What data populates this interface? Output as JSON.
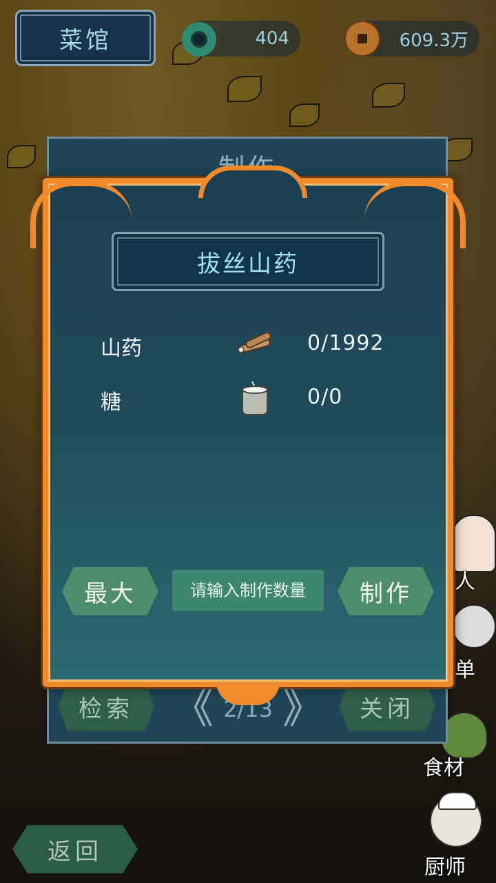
{
  "header": {
    "title": "菜馆",
    "jade_amount": "404",
    "coin_amount": "609.3万"
  },
  "background_panel": {
    "title": "制作",
    "search_label": "检索",
    "close_label": "关闭",
    "page_indicator": "2/13",
    "prev_glyph": "《",
    "next_glyph": "》"
  },
  "dialog": {
    "recipe_name": "拔丝山药",
    "ingredients": [
      {
        "name": "山药",
        "icon": "yam-icon",
        "quantity": "0/1992"
      },
      {
        "name": "糖",
        "icon": "sugar-pot-icon",
        "quantity": "0/0"
      }
    ],
    "max_label": "最大",
    "quantity_placeholder": "请输入制作数量",
    "make_label": "制作"
  },
  "side_menu": {
    "people_label": "人",
    "menu_label": "单",
    "ingredients_label": "食材",
    "chef_label": "厨师"
  },
  "footer": {
    "back_label": "返回"
  },
  "colors": {
    "frame_orange": "#f08a2a",
    "panel_teal": "#1f4a5a",
    "button_green": "#4d8d6c",
    "title_text": "#9fe1ee"
  }
}
